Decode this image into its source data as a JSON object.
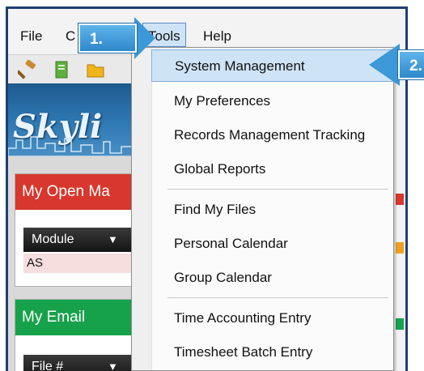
{
  "menubar": {
    "file_label": "File",
    "partial_label": "C",
    "tools_label": "Tools",
    "help_label": "Help"
  },
  "toolbar": {
    "icons": [
      "gavel-icon",
      "document-icon",
      "folder-icon"
    ]
  },
  "banner": {
    "text": "Skyli"
  },
  "panels": {
    "open_matters": {
      "title": "My Open Ma",
      "column": "Module",
      "row_value": "AS"
    },
    "email": {
      "title": "My Email",
      "column": "File #"
    }
  },
  "dropdown": {
    "items": [
      "System Management",
      "My Preferences",
      "Records Management Tracking",
      "Global Reports",
      "Find My Files",
      "Personal Calendar",
      "Group Calendar",
      "Time Accounting Entry",
      "Timesheet Batch Entry"
    ]
  },
  "callouts": {
    "step1": "1.",
    "step2": "2."
  },
  "colors": {
    "frame": "#1e3f73",
    "highlight": "#cfe3f6",
    "callout": "#3c98d6",
    "open_matters_header": "#d7372c",
    "email_header": "#16a24a"
  }
}
